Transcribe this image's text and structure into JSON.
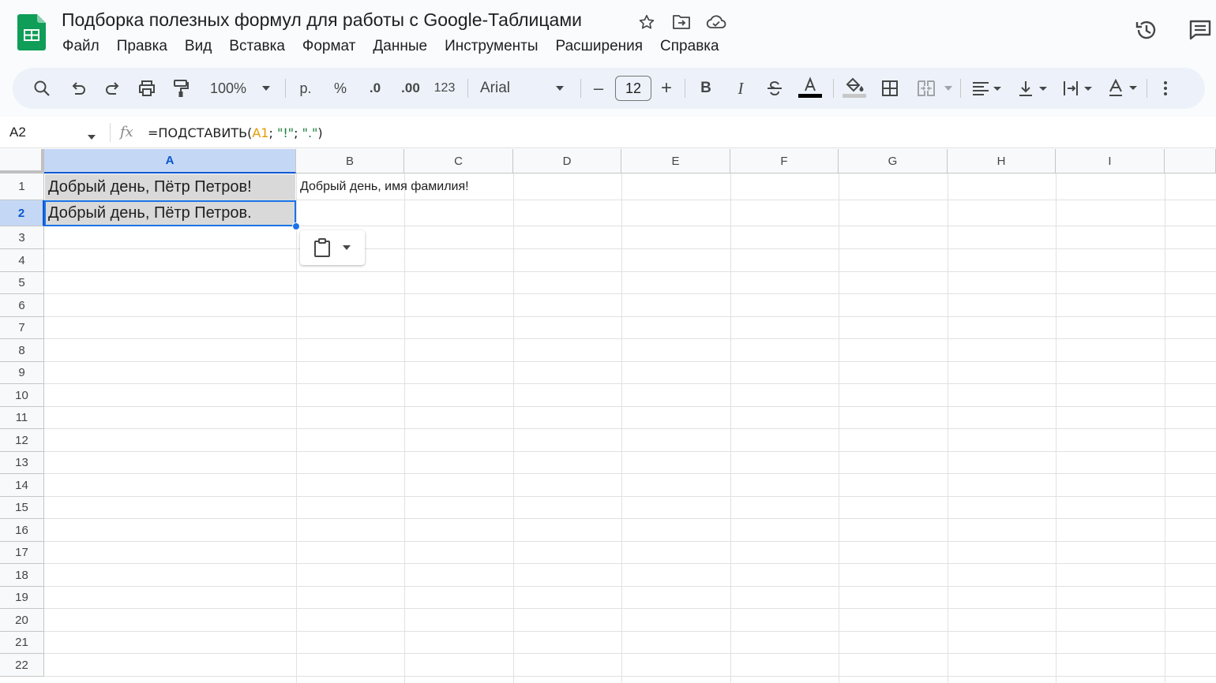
{
  "app": {
    "doc_title": "Подборка полезных формул для работы с Google-Таблицами",
    "brand_color": "#0f9d58",
    "accent_color": "#1a73e8"
  },
  "title_icons": [
    "star-icon",
    "move-to-folder-icon",
    "cloud-saved-icon"
  ],
  "right_icons": [
    "version-history-icon",
    "comments-icon"
  ],
  "menu": [
    "Файл",
    "Правка",
    "Вид",
    "Вставка",
    "Формат",
    "Данные",
    "Инструменты",
    "Расширения",
    "Справка"
  ],
  "toolbar": {
    "zoom": "100%",
    "currency": "р.",
    "percent": "%",
    "decrease_decimal": ".0",
    "increase_decimal": ".00",
    "number_format": "123",
    "font": "Arial",
    "font_size": "12",
    "minus": "–",
    "plus": "+",
    "bold": "B",
    "italic": "I"
  },
  "formula_bar": {
    "name_box": "A2",
    "fx": "fx",
    "formula_prefix": "=ПОДСТАВИТЬ(",
    "formula_ref": "A1",
    "formula_sep1": "; ",
    "formula_arg1": "\"!\"",
    "formula_sep2": "; ",
    "formula_arg2": "\".\"",
    "formula_suffix": ")"
  },
  "sheet": {
    "columns": [
      "A",
      "B",
      "C",
      "D",
      "E",
      "F",
      "G",
      "H",
      "I"
    ],
    "selected_column": "A",
    "rows": [
      "1",
      "2",
      "3",
      "4",
      "5",
      "6",
      "7",
      "8",
      "9",
      "10",
      "11",
      "12",
      "13",
      "14",
      "15",
      "16",
      "17",
      "18",
      "19",
      "20",
      "21",
      "22"
    ],
    "selected_row": "2",
    "cells": {
      "A1": "Добрый день, Пётр Петров!",
      "B1": "Добрый день, имя фамилия!",
      "A2": "Добрый день, Пётр Петров."
    }
  }
}
